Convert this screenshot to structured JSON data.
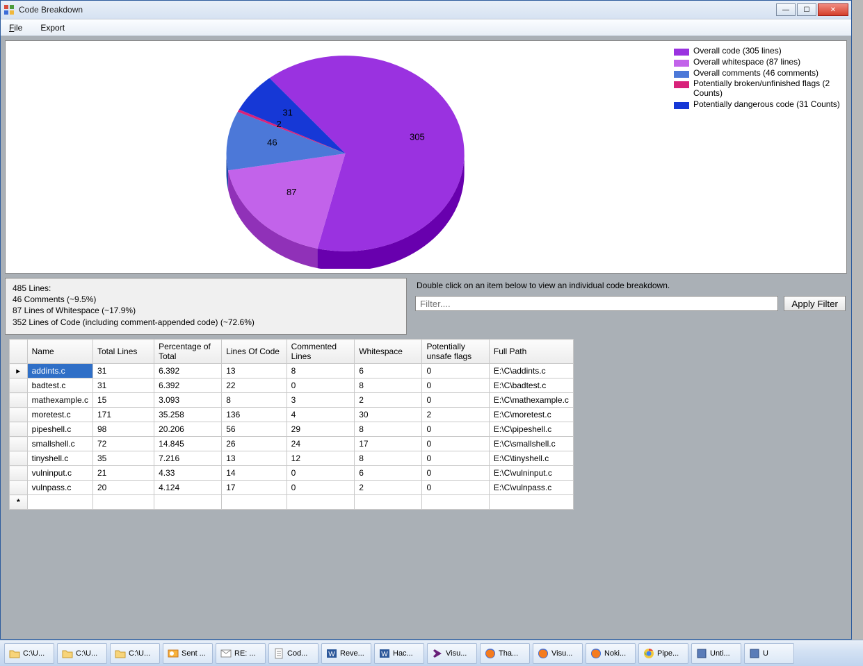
{
  "window": {
    "title": "Code Breakdown"
  },
  "menu": {
    "file": "File",
    "export": "Export"
  },
  "chart_data": {
    "type": "pie",
    "title": "",
    "slices": [
      {
        "label": "Overall code (305 lines)",
        "value": 305,
        "data_label": "305",
        "color": "#9a32e0"
      },
      {
        "label": "Overall whitespace (87 lines)",
        "value": 87,
        "data_label": "87",
        "color": "#c263ea"
      },
      {
        "label": "Overall comments (46 comments)",
        "value": 46,
        "data_label": "46",
        "color": "#4c78d8"
      },
      {
        "label": "Potentially broken/unfinished flags (2 Counts)",
        "value": 2,
        "data_label": "2",
        "color": "#d8227a"
      },
      {
        "label": "Potentially dangerous code (31 Counts)",
        "value": 31,
        "data_label": "31",
        "color": "#1638d6"
      }
    ]
  },
  "stats": {
    "line1": "485 Lines:",
    "line2": "46 Comments (~9.5%)",
    "line3": "87 Lines of Whitespace (~17.9%)",
    "line4": "352 Lines of Code (including comment-appended code) (~72.6%)"
  },
  "filter": {
    "hint": "Double click on an item below to view an individual code breakdown.",
    "placeholder": "Filter....",
    "apply": "Apply Filter"
  },
  "table": {
    "headers": {
      "name": "Name",
      "total": "Total Lines",
      "pct": "Percentage of Total",
      "loc": "Lines Of Code",
      "comm": "Commented Lines",
      "ws": "Whitespace",
      "flags": "Potentially unsafe flags",
      "path": "Full Path"
    },
    "rows": [
      {
        "name": "addints.c",
        "total": "31",
        "pct": "6.392",
        "loc": "13",
        "comm": "8",
        "ws": "6",
        "flags": "0",
        "path": "E:\\C\\addints.c"
      },
      {
        "name": "badtest.c",
        "total": "31",
        "pct": "6.392",
        "loc": "22",
        "comm": "0",
        "ws": "8",
        "flags": "0",
        "path": "E:\\C\\badtest.c"
      },
      {
        "name": "mathexample.c",
        "total": "15",
        "pct": "3.093",
        "loc": "8",
        "comm": "3",
        "ws": "2",
        "flags": "0",
        "path": "E:\\C\\mathexample.c"
      },
      {
        "name": "moretest.c",
        "total": "171",
        "pct": "35.258",
        "loc": "136",
        "comm": "4",
        "ws": "30",
        "flags": "2",
        "path": "E:\\C\\moretest.c"
      },
      {
        "name": "pipeshell.c",
        "total": "98",
        "pct": "20.206",
        "loc": "56",
        "comm": "29",
        "ws": "8",
        "flags": "0",
        "path": "E:\\C\\pipeshell.c"
      },
      {
        "name": "smallshell.c",
        "total": "72",
        "pct": "14.845",
        "loc": "26",
        "comm": "24",
        "ws": "17",
        "flags": "0",
        "path": "E:\\C\\smallshell.c"
      },
      {
        "name": "tinyshell.c",
        "total": "35",
        "pct": "7.216",
        "loc": "13",
        "comm": "12",
        "ws": "8",
        "flags": "0",
        "path": "E:\\C\\tinyshell.c"
      },
      {
        "name": "vulninput.c",
        "total": "21",
        "pct": "4.33",
        "loc": "14",
        "comm": "0",
        "ws": "6",
        "flags": "0",
        "path": "E:\\C\\vulninput.c"
      },
      {
        "name": "vulnpass.c",
        "total": "20",
        "pct": "4.124",
        "loc": "17",
        "comm": "0",
        "ws": "2",
        "flags": "0",
        "path": "E:\\C\\vulnpass.c"
      }
    ]
  },
  "taskbar": [
    {
      "label": "C:\\U...",
      "icon": "folder"
    },
    {
      "label": "C:\\U...",
      "icon": "folder"
    },
    {
      "label": "C:\\U...",
      "icon": "folder"
    },
    {
      "label": "Sent ...",
      "icon": "outlook"
    },
    {
      "label": "RE: ...",
      "icon": "mail"
    },
    {
      "label": "Cod...",
      "icon": "doc"
    },
    {
      "label": "Reve...",
      "icon": "word"
    },
    {
      "label": "Hac...",
      "icon": "word"
    },
    {
      "label": "Visu...",
      "icon": "vs"
    },
    {
      "label": "Tha...",
      "icon": "firefox"
    },
    {
      "label": "Visu...",
      "icon": "firefox"
    },
    {
      "label": "Noki...",
      "icon": "firefox"
    },
    {
      "label": "Pipe...",
      "icon": "chrome"
    },
    {
      "label": "Unti...",
      "icon": "app"
    },
    {
      "label": "U",
      "icon": "app"
    }
  ]
}
